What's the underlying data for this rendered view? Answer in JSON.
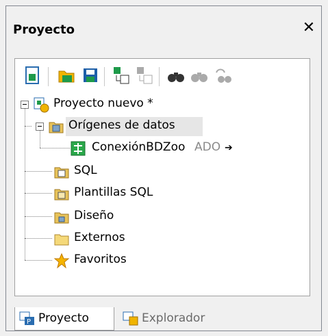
{
  "panel": {
    "title": "Proyecto"
  },
  "toolbar": {
    "buttons": [
      "new-project-icon",
      "open-project-icon",
      "save-project-icon",
      "add-to-project-icon",
      "remove-from-project-icon",
      "find-icon",
      "find-next-icon",
      "replace-icon"
    ]
  },
  "tree": {
    "root": "Proyecto nuevo *",
    "data_sources": "Orígenes de datos",
    "connection_name": "ConexiónBDZoo",
    "connection_type": "ADO",
    "connection_arrow": "➔",
    "sql": "SQL",
    "sql_templates": "Plantillas SQL",
    "design": "Diseño",
    "external": "Externos",
    "favorites": "Favoritos"
  },
  "tabs": {
    "project": "Proyecto",
    "explorer": "Explorador"
  },
  "colors": {
    "folder": "#e8c35a",
    "accent": "#2c7fd6",
    "green": "#2a9a3a"
  }
}
